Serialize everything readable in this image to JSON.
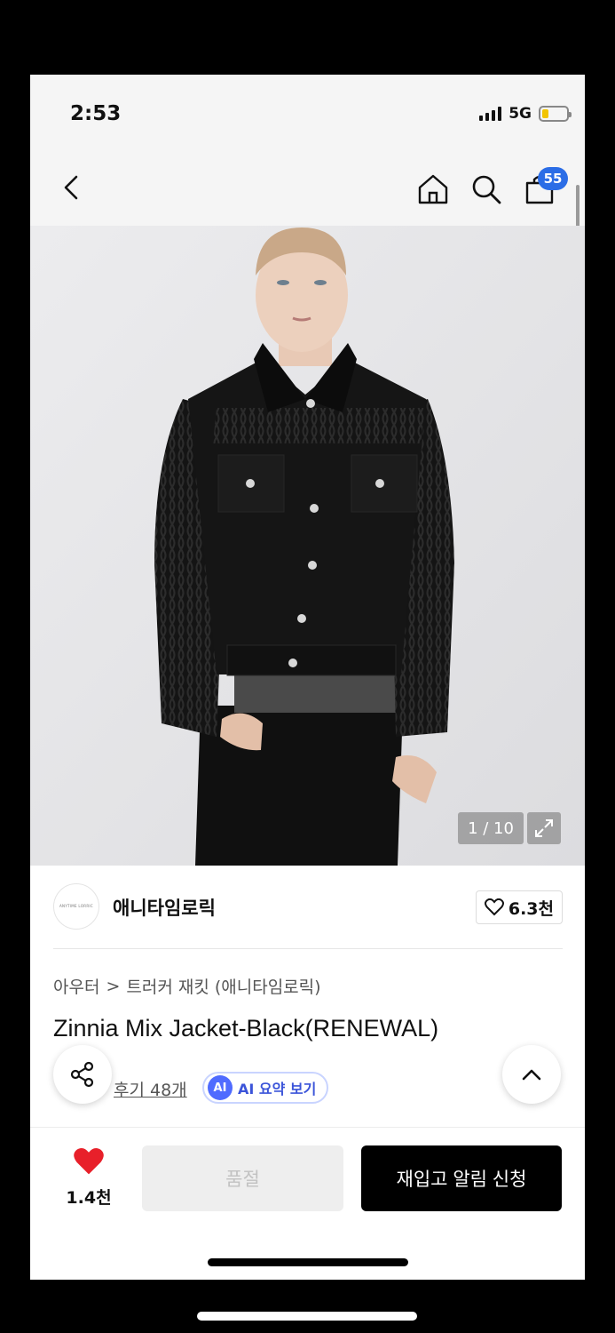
{
  "status_bar": {
    "time": "2:53",
    "network": "5G",
    "battery_level": 0.25
  },
  "nav": {
    "cart_count": "55"
  },
  "gallery": {
    "counter": "1 / 10"
  },
  "brand": {
    "name": "애니타임로릭",
    "logo_text": "ANYTIME LORRIC",
    "likes": "6.3천"
  },
  "breadcrumb": {
    "category": "아우터",
    "separator": ">",
    "subcategory": "트러커 재킷 (애니타임로릭)"
  },
  "product": {
    "title": "Zinnia Mix Jacket-Black(RENEWAL)"
  },
  "review": {
    "link": "후기 48개",
    "ai_badge": "AI",
    "ai_label": "AI 요약 보기"
  },
  "bottom": {
    "wish_count": "1.4천",
    "soldout_label": "품절",
    "restock_label": "재입고 알림 신청"
  },
  "colors": {
    "accent_blue": "#2b6de6",
    "heart_red": "#e8202a",
    "ai_purple": "#4f6bff"
  }
}
